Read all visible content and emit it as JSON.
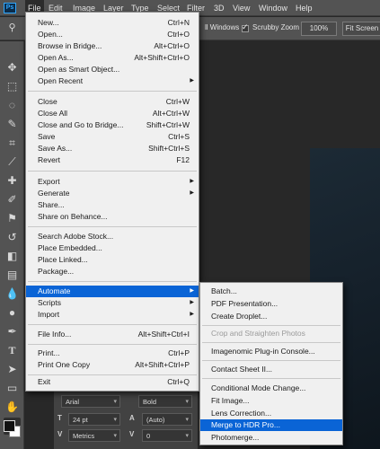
{
  "menubar": {
    "logo": "Ps",
    "items": [
      "File",
      "Edit",
      "Image",
      "Layer",
      "Type",
      "Select",
      "Filter",
      "3D",
      "View",
      "Window",
      "Help"
    ]
  },
  "options": {
    "all_windows": "ll Windows",
    "scrubby_zoom": "Scrubby Zoom",
    "zoom_value": "100%",
    "fit_screen": "Fit Screen"
  },
  "file_menu": {
    "items": [
      {
        "label": "New...",
        "shortcut": "Ctrl+N"
      },
      {
        "label": "Open...",
        "shortcut": "Ctrl+O"
      },
      {
        "label": "Browse in Bridge...",
        "shortcut": "Alt+Ctrl+O"
      },
      {
        "label": "Open As...",
        "shortcut": "Alt+Shift+Ctrl+O"
      },
      {
        "label": "Open as Smart Object...",
        "shortcut": ""
      },
      {
        "label": "Open Recent",
        "shortcut": ""
      },
      {
        "label": "Close",
        "shortcut": "Ctrl+W"
      },
      {
        "label": "Close All",
        "shortcut": "Alt+Ctrl+W"
      },
      {
        "label": "Close and Go to Bridge...",
        "shortcut": "Shift+Ctrl+W"
      },
      {
        "label": "Save",
        "shortcut": "Ctrl+S"
      },
      {
        "label": "Save As...",
        "shortcut": "Shift+Ctrl+S"
      },
      {
        "label": "Revert",
        "shortcut": "F12"
      },
      {
        "label": "Export",
        "shortcut": ""
      },
      {
        "label": "Generate",
        "shortcut": ""
      },
      {
        "label": "Share...",
        "shortcut": ""
      },
      {
        "label": "Share on Behance...",
        "shortcut": ""
      },
      {
        "label": "Search Adobe Stock...",
        "shortcut": ""
      },
      {
        "label": "Place Embedded...",
        "shortcut": ""
      },
      {
        "label": "Place Linked...",
        "shortcut": ""
      },
      {
        "label": "Package...",
        "shortcut": ""
      },
      {
        "label": "Automate",
        "shortcut": ""
      },
      {
        "label": "Scripts",
        "shortcut": ""
      },
      {
        "label": "Import",
        "shortcut": ""
      },
      {
        "label": "File Info...",
        "shortcut": "Alt+Shift+Ctrl+I"
      },
      {
        "label": "Print...",
        "shortcut": "Ctrl+P"
      },
      {
        "label": "Print One Copy",
        "shortcut": "Alt+Shift+Ctrl+P"
      },
      {
        "label": "Exit",
        "shortcut": "Ctrl+Q"
      }
    ]
  },
  "automate_submenu": {
    "items": [
      "Batch...",
      "PDF Presentation...",
      "Create Droplet...",
      "Crop and Straighten Photos",
      "Imagenomic Plug-in Console...",
      "Contact Sheet II...",
      "Conditional Mode Change...",
      "Fit Image...",
      "Lens Correction...",
      "Merge to HDR Pro...",
      "Photomerge..."
    ]
  },
  "character_panel": {
    "font": "Arial",
    "style": "Bold",
    "size": "24 pt",
    "leading": "(Auto)",
    "kerning": "Metrics",
    "tracking": "0"
  },
  "colors": {
    "highlight": "#0a64d6",
    "menu_bg": "#f0f0f0",
    "chrome": "#535353"
  }
}
